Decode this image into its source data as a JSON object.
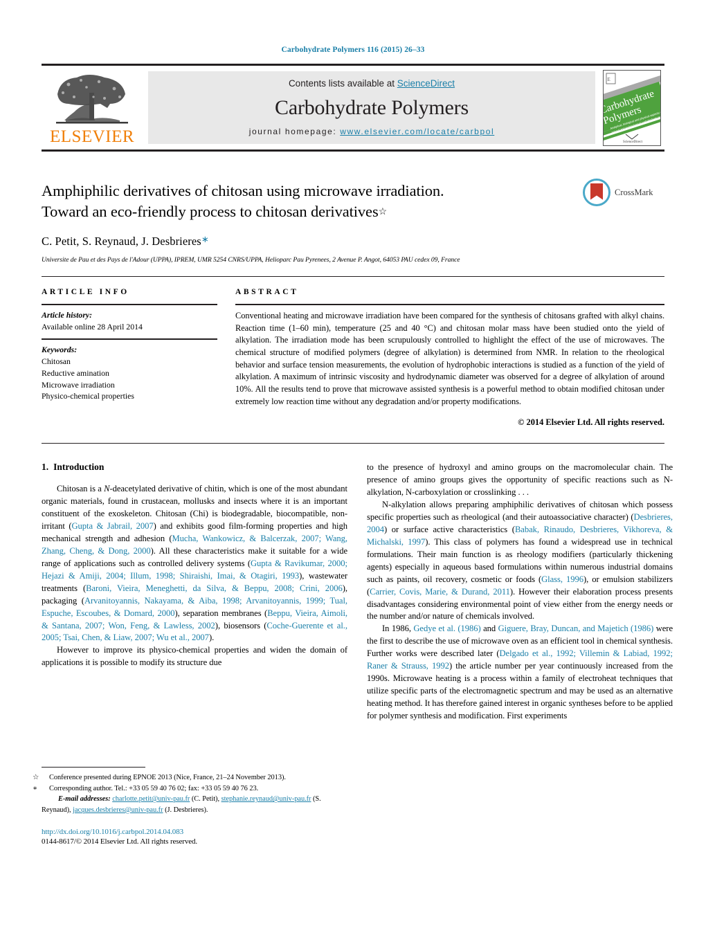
{
  "running_head": "Carbohydrate Polymers 116 (2015) 26–33",
  "masthead": {
    "publisher_logo_text": "ELSEVIER",
    "contents_prefix": "Contents lists available at ",
    "contents_link": "ScienceDirect",
    "journal_title": "Carbohydrate Polymers",
    "homepage_prefix": "journal homepage: ",
    "homepage_url": "www.elsevier.com/locate/carbpol",
    "cover_title_line1": "Carbohydrate",
    "cover_title_line2": "Polymers",
    "cover_footer": "ScienceDirect"
  },
  "article": {
    "title_line1": "Amphiphilic derivatives of chitosan using microwave irradiation.",
    "title_line2": "Toward an eco-friendly process to chitosan derivatives",
    "title_footnote_mark": "☆",
    "authors": "C. Petit, S. Reynaud, J. Desbrieres",
    "author_corr_mark": "∗",
    "affiliation": "Universite de Pau et des Pays de l'Adour (UPPA), IPREM, UMR 5254 CNRS/UPPA, Helioparc Pau Pyrenees, 2 Avenue P. Angot, 64053 PAU cedex 09, France",
    "crossmark_label": "CrossMark"
  },
  "article_info": {
    "heading": "ARTICLE INFO",
    "history_label": "Article history:",
    "history_value": "Available online 28 April 2014",
    "keywords_label": "Keywords:",
    "keywords": [
      "Chitosan",
      "Reductive amination",
      "Microwave irradiation",
      "Physico-chemical properties"
    ]
  },
  "abstract": {
    "heading": "ABSTRACT",
    "text": "Conventional heating and microwave irradiation have been compared for the synthesis of chitosans grafted with alkyl chains. Reaction time (1–60 min), temperature (25 and 40 °C) and chitosan molar mass have been studied onto the yield of alkylation. The irradiation mode has been scrupulously controlled to highlight the effect of the use of microwaves. The chemical structure of modified polymers (degree of alkylation) is determined from NMR. In relation to the rheological behavior and surface tension measurements, the evolution of hydrophobic interactions is studied as a function of the yield of alkylation. A maximum of intrinsic viscosity and hydrodynamic diameter was observed for a degree of alkylation of around 10%. All the results tend to prove that microwave assisted synthesis is a powerful method to obtain modified chitosan under extremely low reaction time without any degradation and/or property modifications.",
    "copyright": "© 2014 Elsevier Ltd. All rights reserved."
  },
  "section": {
    "number": "1.",
    "heading": "Introduction"
  },
  "body": {
    "left": [
      "Chitosan is a <i>N</i>-deacetylated derivative of chitin, which is one of the most abundant organic materials, found in crustacean, mollusks and insects where it is an important constituent of the exoskeleton. Chitosan (Chi) is biodegradable, biocompatible, non-irritant (<span class=\"ref\">Gupta &amp; Jabrail, 2007</span>) and exhibits good film-forming properties and high mechanical strength and adhesion (<span class=\"ref\">Mucha, Wankowicz, &amp; Balcerzak, 2007; Wang, Zhang, Cheng, &amp; Dong, 2000</span>). All these characteristics make it suitable for a wide range of applications such as controlled delivery systems (<span class=\"ref\">Gupta &amp; Ravikumar, 2000; Hejazi &amp; Amiji, 2004; Illum, 1998; Shiraishi, Imai, &amp; Otagiri, 1993</span>), wastewater treatments (<span class=\"ref\">Baroni, Vieira, Meneghetti, da Silva, &amp; Beppu, 2008; Crini, 2006</span>), packaging (<span class=\"ref\">Arvanitoyannis, Nakayama, &amp; Aiba, 1998; Arvanitoyannis, 1999; Tual, Espuche, Escoubes, &amp; Domard, 2000</span>), separation membranes (<span class=\"ref\">Beppu, Vieira, Aimoli, &amp; Santana, 2007; Won, Feng, &amp; Lawless, 2002</span>), biosensors (<span class=\"ref\">Coche-Guerente et al., 2005; Tsai, Chen, &amp; Liaw, 2007; Wu et al., 2007</span>).",
      "However to improve its physico-chemical properties and widen the domain of applications it is possible to modify its structure due"
    ],
    "right": [
      "to the presence of hydroxyl and amino groups on the macromolecular chain. The presence of amino groups gives the opportunity of specific reactions such as N-alkylation, N-carboxylation or crosslinking . . .",
      "N-alkylation allows preparing amphiphilic derivatives of chitosan which possess specific properties such as rheological (and their autoassociative character) (<span class=\"ref\">Desbrieres, 2004</span>) or surface active characteristics (<span class=\"ref\">Babak, Rinaudo, Desbrieres, Vikhoreva, &amp; Michalski, 1997</span>). This class of polymers has found a widespread use in technical formulations. Their main function is as rheology modifiers (particularly thickening agents) especially in aqueous based formulations within numerous industrial domains such as paints, oil recovery, cosmetic or foods (<span class=\"ref\">Glass, 1996</span>), or emulsion stabilizers (<span class=\"ref\">Carrier, Covis, Marie, &amp; Durand, 2011</span>). However their elaboration process presents disadvantages considering environmental point of view either from the energy needs or the number and/or nature of chemicals involved.",
      "In 1986, <span class=\"ref\">Gedye et al. (1986)</span> and <span class=\"ref\">Giguere, Bray, Duncan, and Majetich (1986)</span> were the first to describe the use of microwave oven as an efficient tool in chemical synthesis. Further works were described later (<span class=\"ref\">Delgado et al., 1992; Villemin &amp; Labiad, 1992; Raner &amp; Strauss, 1992</span>) the article number per year continuously increased from the 1990s. Microwave heating is a process within a family of electroheat techniques that utilize specific parts of the electromagnetic spectrum and may be used as an alternative heating method. It has therefore gained interest in organic syntheses before to be applied for polymer synthesis and modification. First experiments"
    ]
  },
  "footnotes": {
    "conference_mark": "☆",
    "conference": "Conference presented during EPNOE 2013 (Nice, France, 21–24 November 2013).",
    "corresponding_mark": "∗",
    "corresponding": "Corresponding author. Tel.: +33 05 59 40 76 02; fax: +33 05 59 40 76 23.",
    "email_label": "E-mail addresses:",
    "emails": [
      {
        "address": "charlotte.petit@univ-pau.fr",
        "name": "(C. Petit),"
      },
      {
        "address": "stephanie.reynaud@univ-pau.fr",
        "name": "(S. Reynaud),"
      },
      {
        "address": "jacques.desbrieres@univ-pau.fr",
        "name": "(J. Desbrieres)."
      }
    ],
    "doi": "http://dx.doi.org/10.1016/j.carbpol.2014.04.083",
    "issn": "0144-8617/© 2014 Elsevier Ltd. All rights reserved."
  },
  "colors": {
    "link": "#1a7fa8",
    "elsevier_orange": "#F07F09",
    "cover_green": "#4fa23e",
    "crossmark_blue": "#4aa9c9",
    "crossmark_red": "#c8392b"
  }
}
